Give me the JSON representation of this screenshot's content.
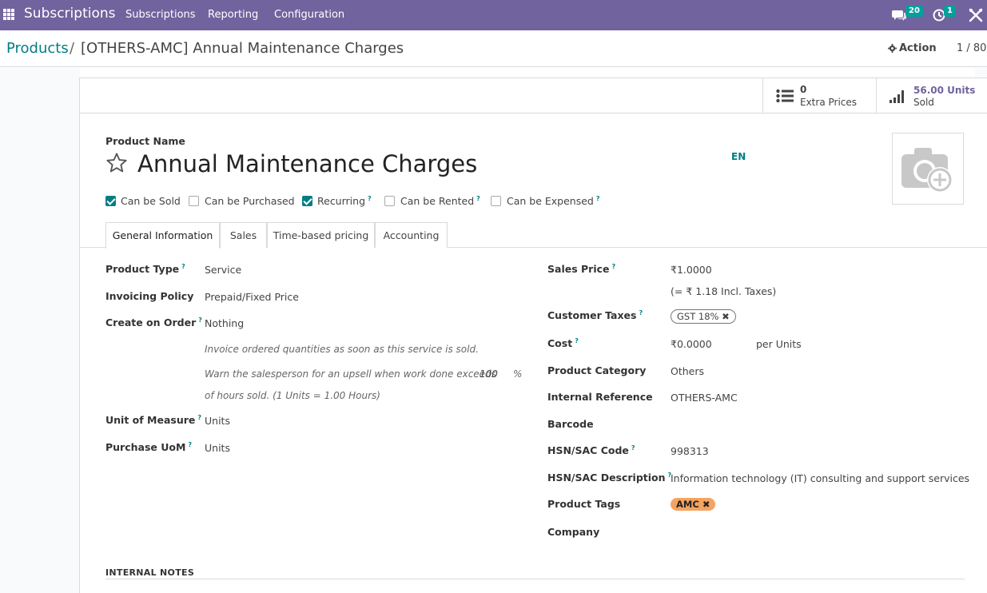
{
  "navbar": {
    "app_name": "Subscriptions",
    "menu": [
      "Subscriptions",
      "Reporting",
      "Configuration"
    ],
    "messages_badge": "20",
    "activities_badge": "1",
    "bg_color": "#71639e"
  },
  "breadcrumb": {
    "parent": "Products",
    "separator": "/",
    "current": "[OTHERS-AMC] Annual Maintenance Charges"
  },
  "control": {
    "action_label": "Action",
    "pager": "1 / 80"
  },
  "stat_buttons": {
    "extra_prices": {
      "value": "0",
      "label": "Extra Prices"
    },
    "units_sold": {
      "value": "56.00 Units",
      "label": "Sold"
    }
  },
  "product": {
    "name_label": "Product Name",
    "name": "Annual Maintenance Charges",
    "lang": "EN"
  },
  "checkboxes": [
    {
      "label": "Can be Sold",
      "checked": true,
      "help": false
    },
    {
      "label": "Can be Purchased",
      "checked": false,
      "help": false
    },
    {
      "label": "Recurring",
      "checked": true,
      "help": true
    },
    {
      "label": "Can be Rented",
      "checked": false,
      "help": true
    },
    {
      "label": "Can be Expensed",
      "checked": false,
      "help": true
    }
  ],
  "tabs": [
    "General Information",
    "Sales",
    "Time-based pricing",
    "Accounting"
  ],
  "left": {
    "product_type_label": "Product Type",
    "product_type": "Service",
    "invoicing_policy_label": "Invoicing Policy",
    "invoicing_policy": "Prepaid/Fixed Price",
    "create_on_order_label": "Create on Order",
    "create_on_order": "Nothing",
    "note_invoice": "Invoice ordered quantities as soon as this service is sold.",
    "note_upsell": "Warn the salesperson for an upsell when work done exceeds",
    "upsell_value": "100",
    "upsell_unit": "%",
    "note_hours": "of hours sold. (1 Units = 1.00 Hours)",
    "uom_label": "Unit of Measure",
    "uom": "Units",
    "purchase_uom_label": "Purchase UoM",
    "purchase_uom": "Units"
  },
  "right": {
    "sales_price_label": "Sales Price",
    "sales_price": "₹1.0000",
    "incl_taxes": "(= ₹ 1.18 Incl. Taxes)",
    "customer_taxes_label": "Customer Taxes",
    "customer_tax_tag": "GST 18%",
    "cost_label": "Cost",
    "cost": "₹0.0000",
    "cost_per": "per Units",
    "category_label": "Product Category",
    "category": "Others",
    "internal_ref_label": "Internal Reference",
    "internal_ref": "OTHERS-AMC",
    "barcode_label": "Barcode",
    "hsn_code_label": "HSN/SAC Code",
    "hsn_code": "998313",
    "hsn_desc_label": "HSN/SAC Description",
    "hsn_desc": "Information technology (IT) consulting and support services",
    "tags_label": "Product Tags",
    "tag": "AMC",
    "company_label": "Company"
  },
  "notes": {
    "heading": "INTERNAL NOTES"
  },
  "colors": {
    "primary": "#017e84",
    "brand": "#71639e",
    "tag_amc": "#f4a460",
    "badge": "#00a09d"
  }
}
